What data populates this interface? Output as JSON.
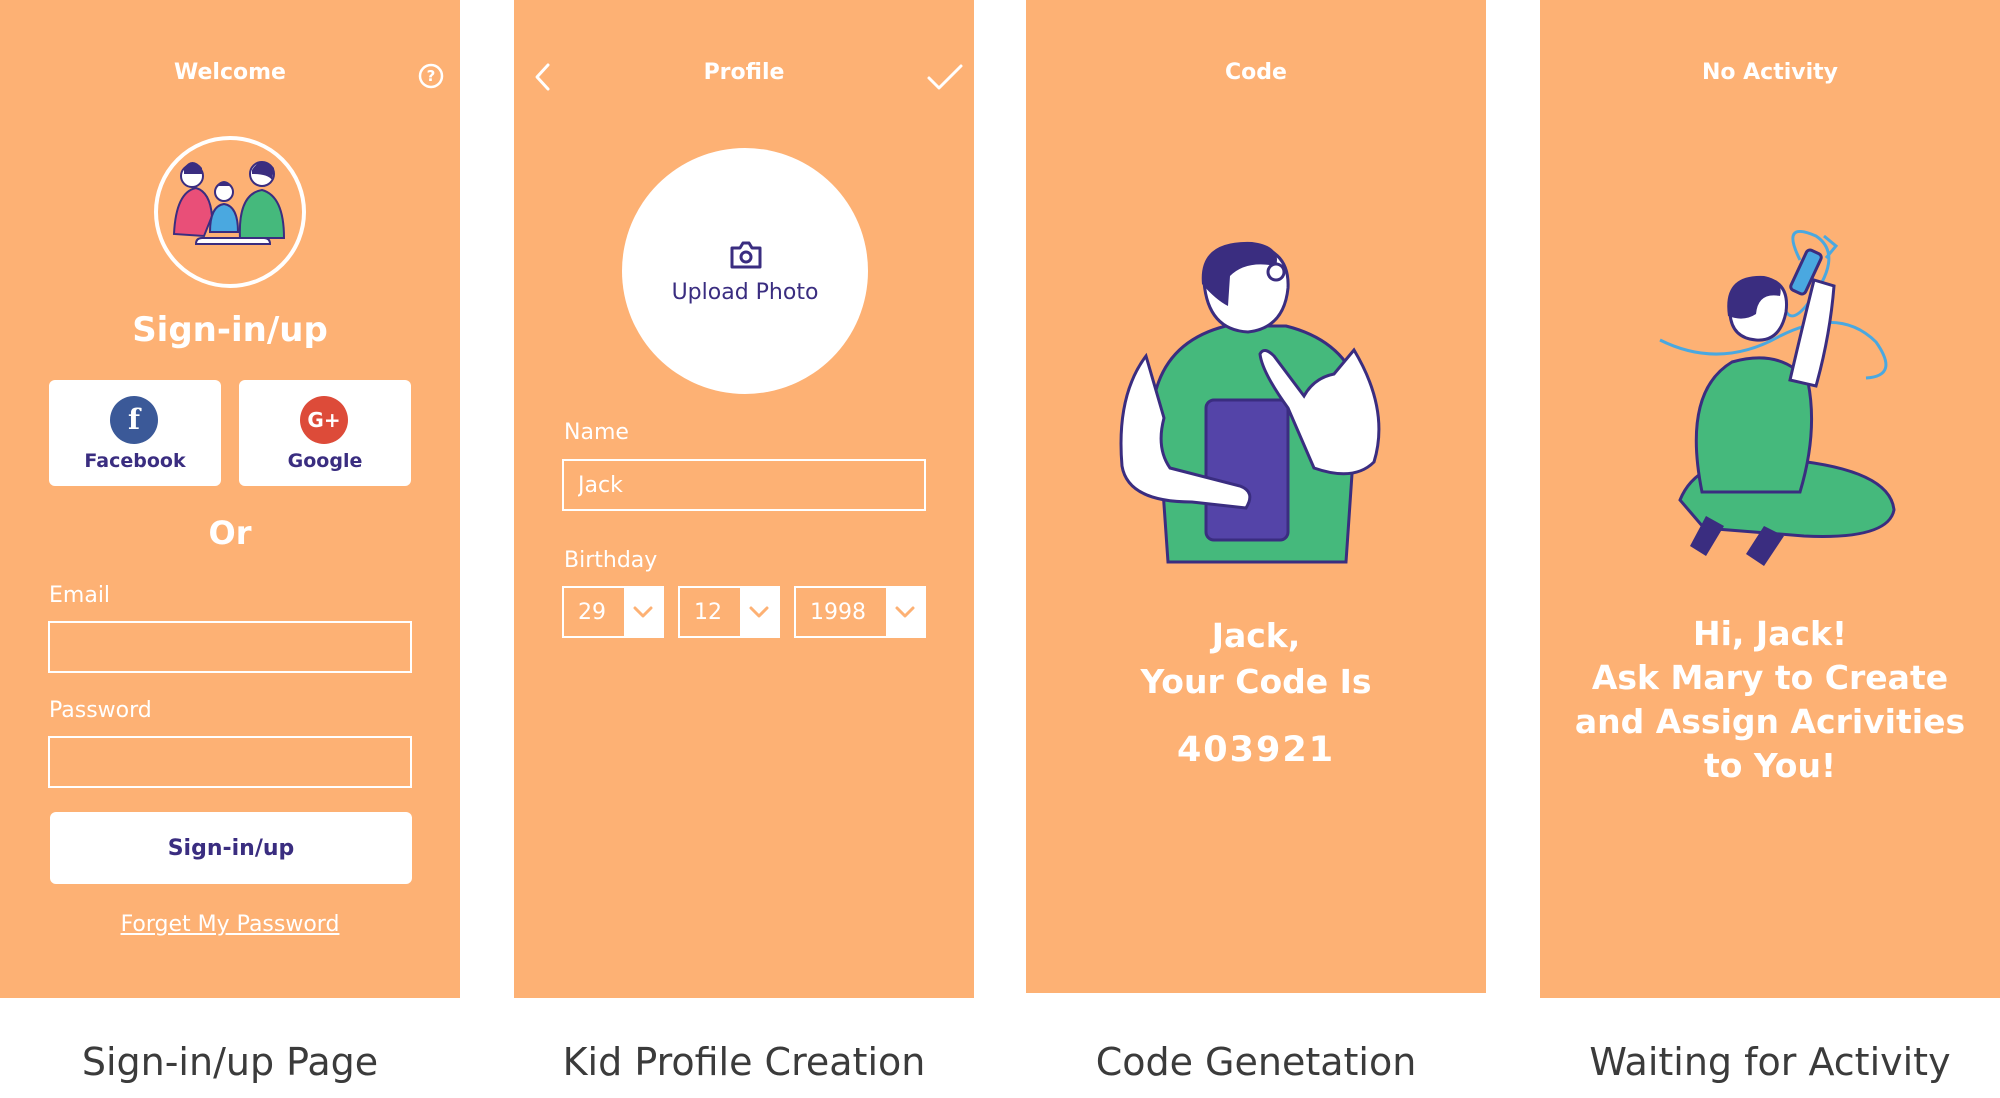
{
  "screens": {
    "signin": {
      "title": "Welcome",
      "heading": "Sign-in/up",
      "facebook_label": "Facebook",
      "google_label": "Google",
      "or_label": "Or",
      "email_label": "Email",
      "email_value": "",
      "password_label": "Password",
      "password_value": "",
      "submit_label": "Sign-in/up",
      "forgot_label": "Forget My Password",
      "caption": "Sign-in/up Page"
    },
    "profile": {
      "title": "Profile",
      "upload_label": "Upload Photo",
      "name_label": "Name",
      "name_value": "Jack",
      "birthday_label": "Birthday",
      "day_value": "29",
      "month_value": "12",
      "year_value": "1998",
      "caption": "Kid Profile Creation"
    },
    "code": {
      "title": "Code",
      "line1": "Jack,",
      "line2": "Your Code Is",
      "code_value": "403921",
      "caption": "Code Genetation"
    },
    "noactivity": {
      "title": "No Activity",
      "line1": "Hi, Jack!",
      "line2": "Ask Mary to Create",
      "line3": "and Assign Acrivities",
      "line4": "to You!",
      "caption": "Waiting for Activity"
    }
  },
  "colors": {
    "background": "#FDB174",
    "accent": "#3a2d80",
    "green": "#45B97C",
    "facebook": "#3b5998",
    "google": "#dd4b39"
  }
}
